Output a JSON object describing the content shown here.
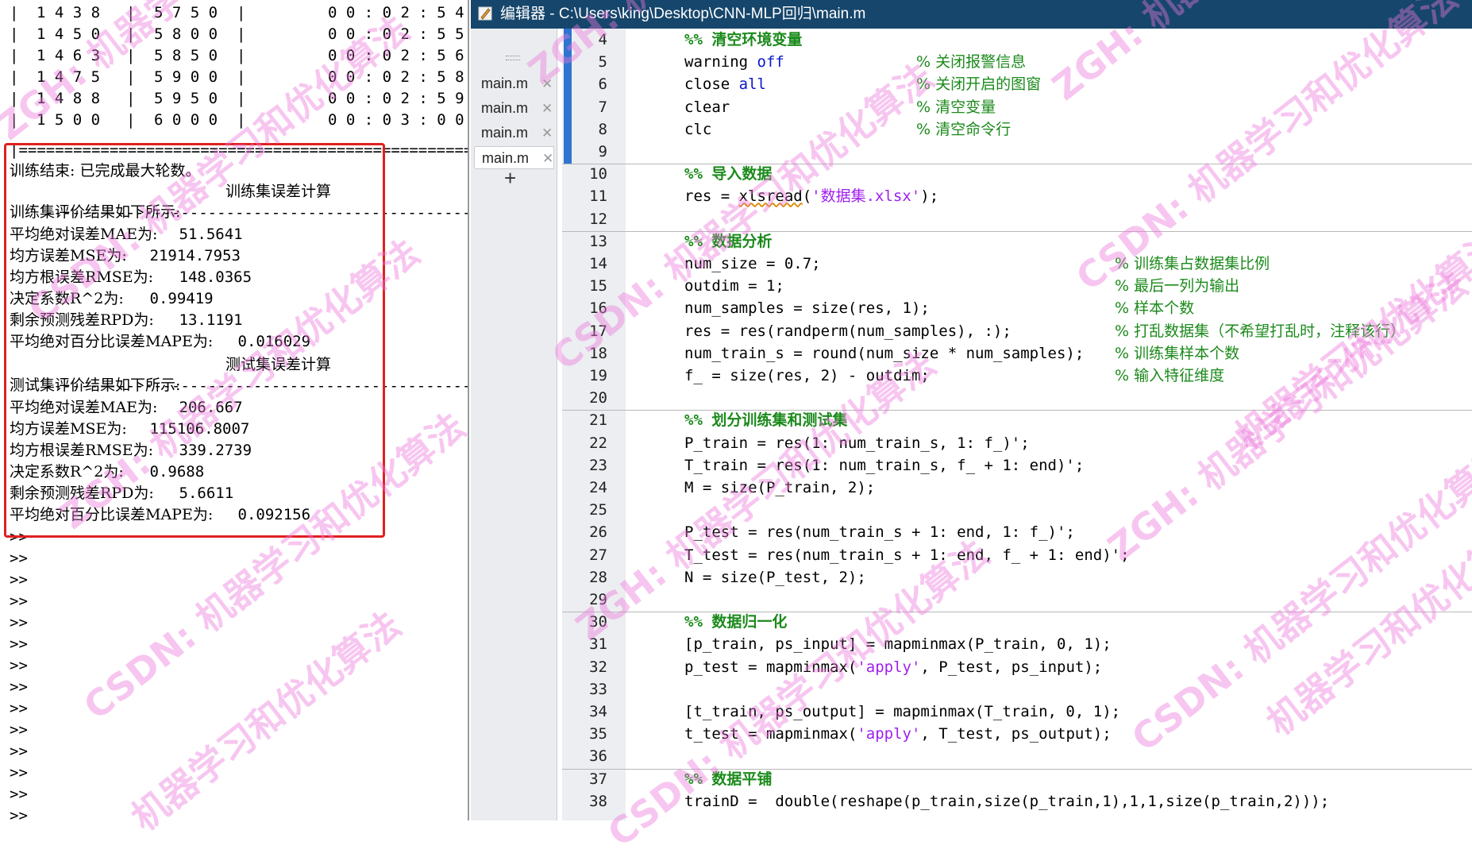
{
  "command_window": {
    "top_table": [
      {
        "a": "1438",
        "b": "5750",
        "c": "00:02:54"
      },
      {
        "a": "1450",
        "b": "5800",
        "c": "00:02:55"
      },
      {
        "a": "1463",
        "b": "5850",
        "c": "00:02:56"
      },
      {
        "a": "1475",
        "b": "5900",
        "c": "00:02:58"
      },
      {
        "a": "1488",
        "b": "5950",
        "c": "00:02:59"
      },
      {
        "a": "1500",
        "b": "6000",
        "c": "00:03:00"
      }
    ],
    "table_border": "|=============================================================",
    "training_done": "训练结束: 已完成最大轮数。",
    "train_sep_title": "训练集误差计算",
    "train_header": "训练集评价结果如下所示:",
    "train_metrics": [
      {
        "label": "平均绝对误差MAE为:",
        "value": "51.5641"
      },
      {
        "label": "均方误差MSE为:",
        "value": "21914.7953"
      },
      {
        "label": "均方根误差RMSE为:",
        "value": "148.0365"
      },
      {
        "label": "决定系数R^2为:",
        "value": "0.99419"
      },
      {
        "label": "剩余预测残差RPD为:",
        "value": "13.1191"
      },
      {
        "label": "平均绝对百分比误差MAPE为:",
        "value": "0.016029"
      }
    ],
    "test_sep_title": "测试集误差计算",
    "test_header": "测试集评价结果如下所示:",
    "test_metrics": [
      {
        "label": "平均绝对误差MAE为:",
        "value": "206.667"
      },
      {
        "label": "均方误差MSE为:",
        "value": "115106.8007"
      },
      {
        "label": "均方根误差RMSE为:",
        "value": "339.2739"
      },
      {
        "label": "决定系数R^2为:",
        "value": "0.9688"
      },
      {
        "label": "剩余预测残差RPD为:",
        "value": "5.6611"
      },
      {
        "label": "平均绝对百分比误差MAPE为:",
        "value": "0.092156"
      }
    ],
    "prompt": ">>",
    "prompt_count": 14
  },
  "editor": {
    "title": "编辑器 - C:\\Users\\king\\Desktop\\CNN-MLP回归\\main.m",
    "tabs": [
      {
        "label": "main.m",
        "close": "✕"
      },
      {
        "label": "main.m",
        "close": "✕"
      },
      {
        "label": "main.m",
        "close": "✕"
      },
      {
        "label": "main.m",
        "close": "✕"
      }
    ],
    "add_tab": "+",
    "colors": {
      "keyword": "#0a18c8",
      "string": "#a020f0",
      "comment": "#1b8a1b",
      "title_bar": "#16466b",
      "accent_bar": "#2f74d0"
    },
    "lines": [
      {
        "n": "4",
        "code": [
          [
            "sec",
            "%% 清空环境变量"
          ]
        ]
      },
      {
        "n": "5",
        "code": [
          [
            "",
            "warning "
          ],
          [
            "kw",
            "off"
          ]
        ],
        "comment": "% 关闭报警信息",
        "cx": "a"
      },
      {
        "n": "6",
        "code": [
          [
            "",
            "close "
          ],
          [
            "kw",
            "all"
          ]
        ],
        "comment": "% 关闭开启的图窗",
        "cx": "a"
      },
      {
        "n": "7",
        "code": [
          [
            "",
            "clear"
          ]
        ],
        "comment": "% 清空变量",
        "cx": "a"
      },
      {
        "n": "8",
        "code": [
          [
            "",
            "clc"
          ]
        ],
        "comment": "% 清空命令行",
        "cx": "a"
      },
      {
        "n": "9",
        "code": []
      },
      {
        "n": "10",
        "code": [
          [
            "sec",
            "%% 导入数据"
          ]
        ]
      },
      {
        "n": "11",
        "code": [
          [
            "",
            "res = "
          ],
          [
            "sq",
            "xlsread"
          ],
          [
            "",
            "("
          ],
          [
            "str",
            "'数据集.xlsx'"
          ],
          [
            "",
            ");"
          ]
        ]
      },
      {
        "n": "12",
        "code": []
      },
      {
        "n": "13",
        "code": [
          [
            "sec",
            "%% 数据分析"
          ]
        ]
      },
      {
        "n": "14",
        "code": [
          [
            "",
            "num_size = 0.7;"
          ]
        ],
        "comment": "% 训练集占数据集比例",
        "cx": "b"
      },
      {
        "n": "15",
        "code": [
          [
            "",
            "outdim = 1;"
          ]
        ],
        "comment": "% 最后一列为输出",
        "cx": "b"
      },
      {
        "n": "16",
        "code": [
          [
            "",
            "num_samples = size(res, 1);"
          ]
        ],
        "comment": "% 样本个数",
        "cx": "b"
      },
      {
        "n": "17",
        "code": [
          [
            "",
            "res = res(randperm(num_samples), :);"
          ]
        ],
        "comment": "% 打乱数据集（不希望打乱时，注释该行）",
        "cx": "b"
      },
      {
        "n": "18",
        "code": [
          [
            "",
            "num_train_s = round(num_size * num_samples);"
          ]
        ],
        "comment": "% 训练集样本个数",
        "cx": "b"
      },
      {
        "n": "19",
        "code": [
          [
            "",
            "f_ = size(res, 2) - outdim;"
          ]
        ],
        "comment": "% 输入特征维度",
        "cx": "b"
      },
      {
        "n": "20",
        "code": []
      },
      {
        "n": "21",
        "code": [
          [
            "sec",
            "%% 划分训练集和测试集"
          ]
        ]
      },
      {
        "n": "22",
        "code": [
          [
            "",
            "P_train = res(1: num_train_s, 1: f_)';"
          ]
        ]
      },
      {
        "n": "23",
        "code": [
          [
            "",
            "T_train = res(1: num_train_s, f_ + 1: end)';"
          ]
        ]
      },
      {
        "n": "24",
        "code": [
          [
            "",
            "M = size(P_train, 2);"
          ]
        ]
      },
      {
        "n": "25",
        "code": []
      },
      {
        "n": "26",
        "code": [
          [
            "",
            "P_test = res(num_train_s + 1: end, 1: f_)';"
          ]
        ]
      },
      {
        "n": "27",
        "code": [
          [
            "",
            "T_test = res(num_train_s + 1: end, f_ + 1: end)';"
          ]
        ]
      },
      {
        "n": "28",
        "code": [
          [
            "",
            "N = size(P_test, 2);"
          ]
        ]
      },
      {
        "n": "29",
        "code": []
      },
      {
        "n": "30",
        "code": [
          [
            "sec",
            "%% 数据归一化"
          ]
        ]
      },
      {
        "n": "31",
        "code": [
          [
            "",
            "[p_train, ps_input] = mapminmax(P_train, 0, 1);"
          ]
        ]
      },
      {
        "n": "32",
        "code": [
          [
            "",
            "p_test = mapminmax("
          ],
          [
            "str",
            "'apply'"
          ],
          [
            "",
            ", P_test, ps_input);"
          ]
        ]
      },
      {
        "n": "33",
        "code": []
      },
      {
        "n": "34",
        "code": [
          [
            "",
            "[t_train, ps_output] = mapminmax(T_train, 0, 1);"
          ]
        ]
      },
      {
        "n": "35",
        "code": [
          [
            "",
            "t_test = mapminmax("
          ],
          [
            "str",
            "'apply'"
          ],
          [
            "",
            ", T_test, ps_output);"
          ]
        ]
      },
      {
        "n": "36",
        "code": []
      },
      {
        "n": "37",
        "code": [
          [
            "sec",
            "%% 数据平铺"
          ]
        ]
      },
      {
        "n": "38",
        "code": [
          [
            "",
            "trainD =  double(reshape(p_train,size(p_train,1),1,1,size(p_train,2)));"
          ]
        ]
      }
    ]
  },
  "watermark": {
    "lines": [
      "ZGH: 机器学习和优化算法",
      "CSDN: 机器学习和优化算法",
      "机器学习和优化算法"
    ]
  }
}
